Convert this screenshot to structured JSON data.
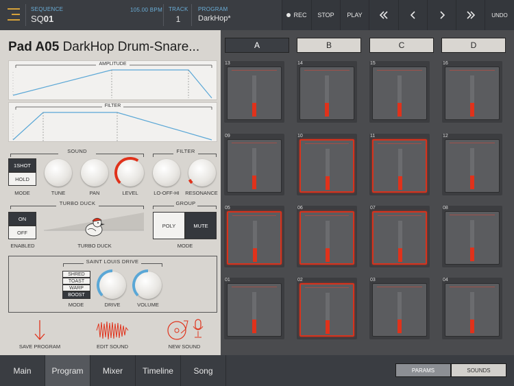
{
  "topbar": {
    "sequence_caption": "SEQUENCE",
    "sequence_prefix": "SQ",
    "sequence_number": "01",
    "bpm": "105.00 BPM",
    "track_caption": "TRACK",
    "track_value": "1",
    "program_caption": "PROGRAM",
    "program_value": "DarkHop*",
    "rec_label": "REC",
    "stop_label": "STOP",
    "play_label": "PLAY",
    "undo_label": "UNDO"
  },
  "pad_title": {
    "id": "Pad A05",
    "name": "DarkHop Drum-Snare..."
  },
  "envelopes": {
    "amplitude": "AMPLITUDE",
    "filter": "FILTER"
  },
  "sound": {
    "section": "SOUND",
    "mode_options": [
      "1SHOT",
      "HOLD"
    ],
    "mode_selected": 0,
    "mode_label": "MODE",
    "knobs": [
      {
        "label": "TUNE",
        "value": 0
      },
      {
        "label": "PAN",
        "value": 0
      },
      {
        "label": "LEVEL",
        "value": 0.62
      }
    ]
  },
  "filter": {
    "section": "FILTER",
    "knobs": [
      {
        "label": "LO-OFF-HI",
        "value": 0
      },
      {
        "label": "RESONANCE",
        "value": 0.06
      }
    ]
  },
  "turbo_duck": {
    "section": "TURBO DUCK",
    "options": [
      "ON",
      "OFF"
    ],
    "selected": 0,
    "enabled_label": "ENABLED",
    "icon_label": "TURBO DUCK"
  },
  "group": {
    "section": "GROUP",
    "options": [
      "POLY",
      "MUTE"
    ],
    "selected": 1,
    "mode_label": "MODE"
  },
  "drive": {
    "section": "SAINT LOUIS DRIVE",
    "modes": [
      "SHRED",
      "TOAST",
      "WARP",
      "BOOST"
    ],
    "selected": 3,
    "mode_label": "MODE",
    "knobs": [
      {
        "label": "DRIVE",
        "value": 0.5
      },
      {
        "label": "VOLUME",
        "value": 0.5
      }
    ]
  },
  "actions": {
    "save_program": "SAVE PROGRAM",
    "edit_sound": "EDIT SOUND",
    "new_sound": "NEW SOUND"
  },
  "banks": {
    "labels": [
      "A",
      "B",
      "C",
      "D"
    ],
    "selected": 0
  },
  "pads": [
    {
      "num": "13",
      "level": 0.55,
      "active": false
    },
    {
      "num": "14",
      "level": 0.55,
      "active": false
    },
    {
      "num": "15",
      "level": 0.55,
      "active": false
    },
    {
      "num": "16",
      "level": 0.55,
      "active": false
    },
    {
      "num": "09",
      "level": 0.55,
      "active": false
    },
    {
      "num": "10",
      "level": 0.55,
      "active": true
    },
    {
      "num": "11",
      "level": 0.55,
      "active": true
    },
    {
      "num": "12",
      "level": 0.55,
      "active": false
    },
    {
      "num": "05",
      "level": 0.55,
      "active": true
    },
    {
      "num": "06",
      "level": 0.55,
      "active": true
    },
    {
      "num": "07",
      "level": 0.55,
      "active": true
    },
    {
      "num": "08",
      "level": 0.55,
      "active": false
    },
    {
      "num": "01",
      "level": 0.55,
      "active": false
    },
    {
      "num": "02",
      "level": 0.55,
      "active": true
    },
    {
      "num": "03",
      "level": 0.55,
      "active": false
    },
    {
      "num": "04",
      "level": 0.55,
      "active": false
    }
  ],
  "tabs": {
    "items": [
      "Main",
      "Program",
      "Mixer",
      "Timeline",
      "Song"
    ],
    "selected": 1
  },
  "view_toggle": {
    "options": [
      "PARAMS",
      "SOUNDS"
    ],
    "selected": 0
  },
  "colors": {
    "accent_red": "#e0321b",
    "accent_blue": "#5aa7d6",
    "menu_gold": "#d6a23a"
  }
}
